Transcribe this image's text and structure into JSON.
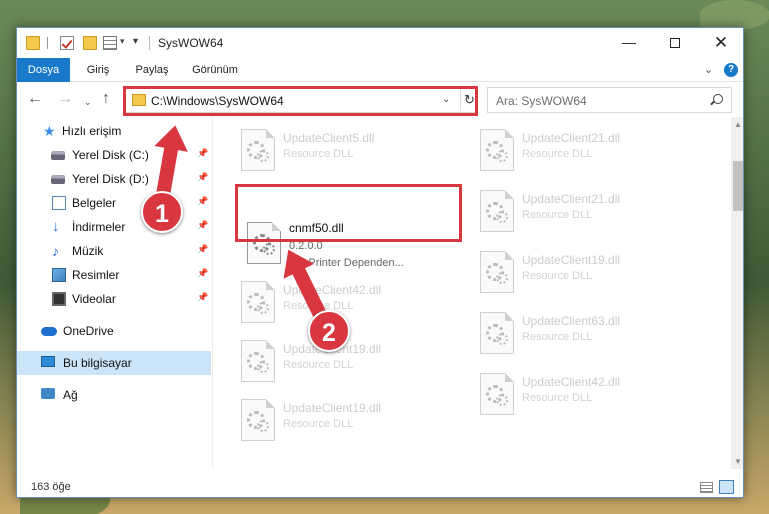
{
  "window": {
    "title": "SysWOW64",
    "minimize_symbol": "—",
    "close_symbol": "✕"
  },
  "ribbon": {
    "tabs": [
      "Dosya",
      "Giriş",
      "Paylaş",
      "Görünüm"
    ],
    "help_symbol": "?"
  },
  "address": {
    "path": "C:\\Windows\\SysWOW64",
    "refresh_symbol": "↻"
  },
  "search": {
    "placeholder": "Ara: SysWOW64"
  },
  "navpane": {
    "quick_access": "Hızlı erişim",
    "items": [
      {
        "label": "Yerel Disk (C:)"
      },
      {
        "label": "Yerel Disk (D:)"
      },
      {
        "label": "Belgeler"
      },
      {
        "label": "İndirmeler"
      },
      {
        "label": "Müzik"
      },
      {
        "label": "Resimler"
      },
      {
        "label": "Videolar"
      }
    ],
    "onedrive": "OneDrive",
    "this_pc": "Bu bilgisayar",
    "network": "Ağ",
    "pin_symbol": "📌"
  },
  "files": {
    "left_column": [
      {
        "name": "UpdateClient5.dll",
        "type": "Resource DLL"
      },
      {
        "name": "UpdateClient42.dll",
        "type": "Resource DLL"
      },
      {
        "name": "UpdateClient19.dll",
        "type": "Resource DLL"
      },
      {
        "name": "UpdateClient19.dll",
        "type": "Resource DLL"
      }
    ],
    "right_column": [
      {
        "name": "UpdateClient21.dll",
        "type": "Resource DLL"
      },
      {
        "name": "UpdateClient21.dll",
        "type": "Resource DLL"
      },
      {
        "name": "UpdateClient19.dll",
        "type": "Resource DLL"
      },
      {
        "name": "UpdateClient63.dll",
        "type": "Resource DLL"
      },
      {
        "name": "UpdateClient42.dll",
        "type": "Resource DLL"
      }
    ],
    "target": {
      "name": "cnmf50.dll",
      "version": "0.2.0.0",
      "description": "MP Printer Dependen..."
    }
  },
  "status": {
    "item_count": "163 öğe"
  },
  "annotations": {
    "badge1": "1",
    "badge2": "2",
    "color": "#d9373f"
  }
}
